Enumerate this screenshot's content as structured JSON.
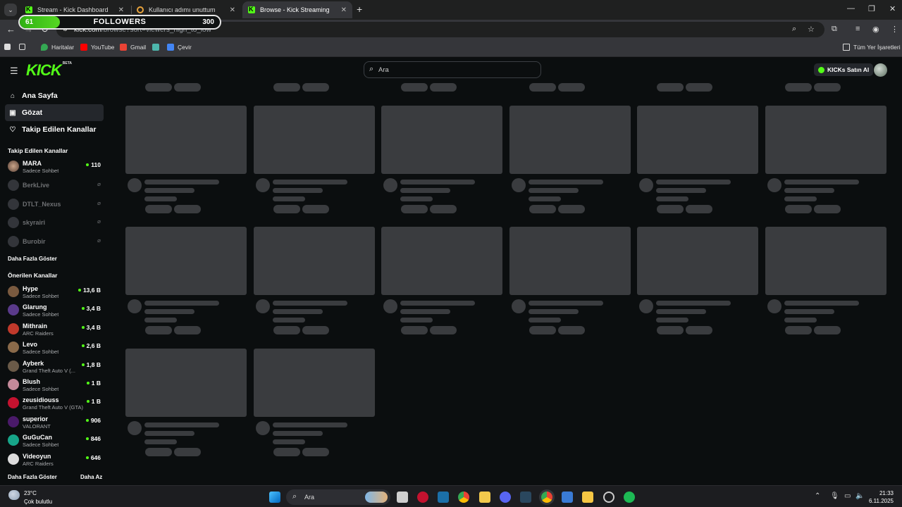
{
  "browser": {
    "tabs": [
      {
        "title": "Stream - Kick Dashboard",
        "active": false
      },
      {
        "title": "Kullanıcı adımı unuttum",
        "active": false
      },
      {
        "title": "Browse - Kick Streaming",
        "active": true
      }
    ],
    "url_host": "kick.com",
    "url_path": "/browse?sort=viewers_high_to_low",
    "bookmarks": [
      "Haritalar",
      "YouTube",
      "Gmail",
      "Çevir"
    ],
    "all_bookmarks": "Tüm Yer İşaretleri"
  },
  "overlay": {
    "followers_label": "FOLLOWERS",
    "current": "61",
    "goal": "300",
    "progress_fraction": 0.2
  },
  "kick": {
    "logo": "KICK",
    "logo_tag": "BETA",
    "search_placeholder": "Ara",
    "buy_button": "KICKs Satın Al",
    "nav": [
      {
        "label": "Ana Sayfa",
        "icon": "home-icon"
      },
      {
        "label": "Gözat",
        "icon": "browse-icon"
      },
      {
        "label": "Takip Edilen Kanallar",
        "icon": "heart-icon"
      }
    ],
    "followed_heading": "Takip Edilen Kanallar",
    "followed": [
      {
        "name": "MARA",
        "category": "Sadece Sohbet",
        "viewers": "110",
        "live": true
      },
      {
        "name": "BerkLive",
        "live": false
      },
      {
        "name": "DTLT_Nexus",
        "live": false
      },
      {
        "name": "skyrairi",
        "live": false
      },
      {
        "name": "Burobir",
        "live": false
      }
    ],
    "followed_more": "Daha Fazla Göster",
    "recommended_heading": "Önerilen Kanallar",
    "recommended": [
      {
        "name": "Hype",
        "category": "Sadece Sohbet",
        "viewers": "13,6 B"
      },
      {
        "name": "Glarung",
        "category": "Sadece Sohbet",
        "viewers": "3,4 B"
      },
      {
        "name": "Mithrain",
        "category": "ARC Raiders",
        "viewers": "3,4 B"
      },
      {
        "name": "Levo",
        "category": "Sadece Sohbet",
        "viewers": "2,6 B"
      },
      {
        "name": "Ayberk",
        "category": "Grand Theft Auto V (...",
        "viewers": "1,8 B"
      },
      {
        "name": "Blush",
        "category": "Sadece Sohbet",
        "viewers": "1 B"
      },
      {
        "name": "zeusidiouss",
        "category": "Grand Theft Auto V (GTA)",
        "viewers": "1 B"
      },
      {
        "name": "superior",
        "category": "VALORANT",
        "viewers": "906"
      },
      {
        "name": "GuGuCan",
        "category": "Sadece Sohbet",
        "viewers": "846"
      },
      {
        "name": "Videoyun",
        "category": "ARC Raiders",
        "viewers": "646"
      }
    ],
    "recommended_more": "Daha Fazla Göster",
    "recommended_less": "Daha Az"
  },
  "taskbar": {
    "temp": "23°C",
    "weather": "Çok bulutlu",
    "search": "Ara",
    "time": "21:33",
    "date": "6.11.2025"
  },
  "colors": {
    "accent": "#53fc18",
    "bg": "#0b0e0f",
    "skeleton": "#3a3c3f"
  }
}
